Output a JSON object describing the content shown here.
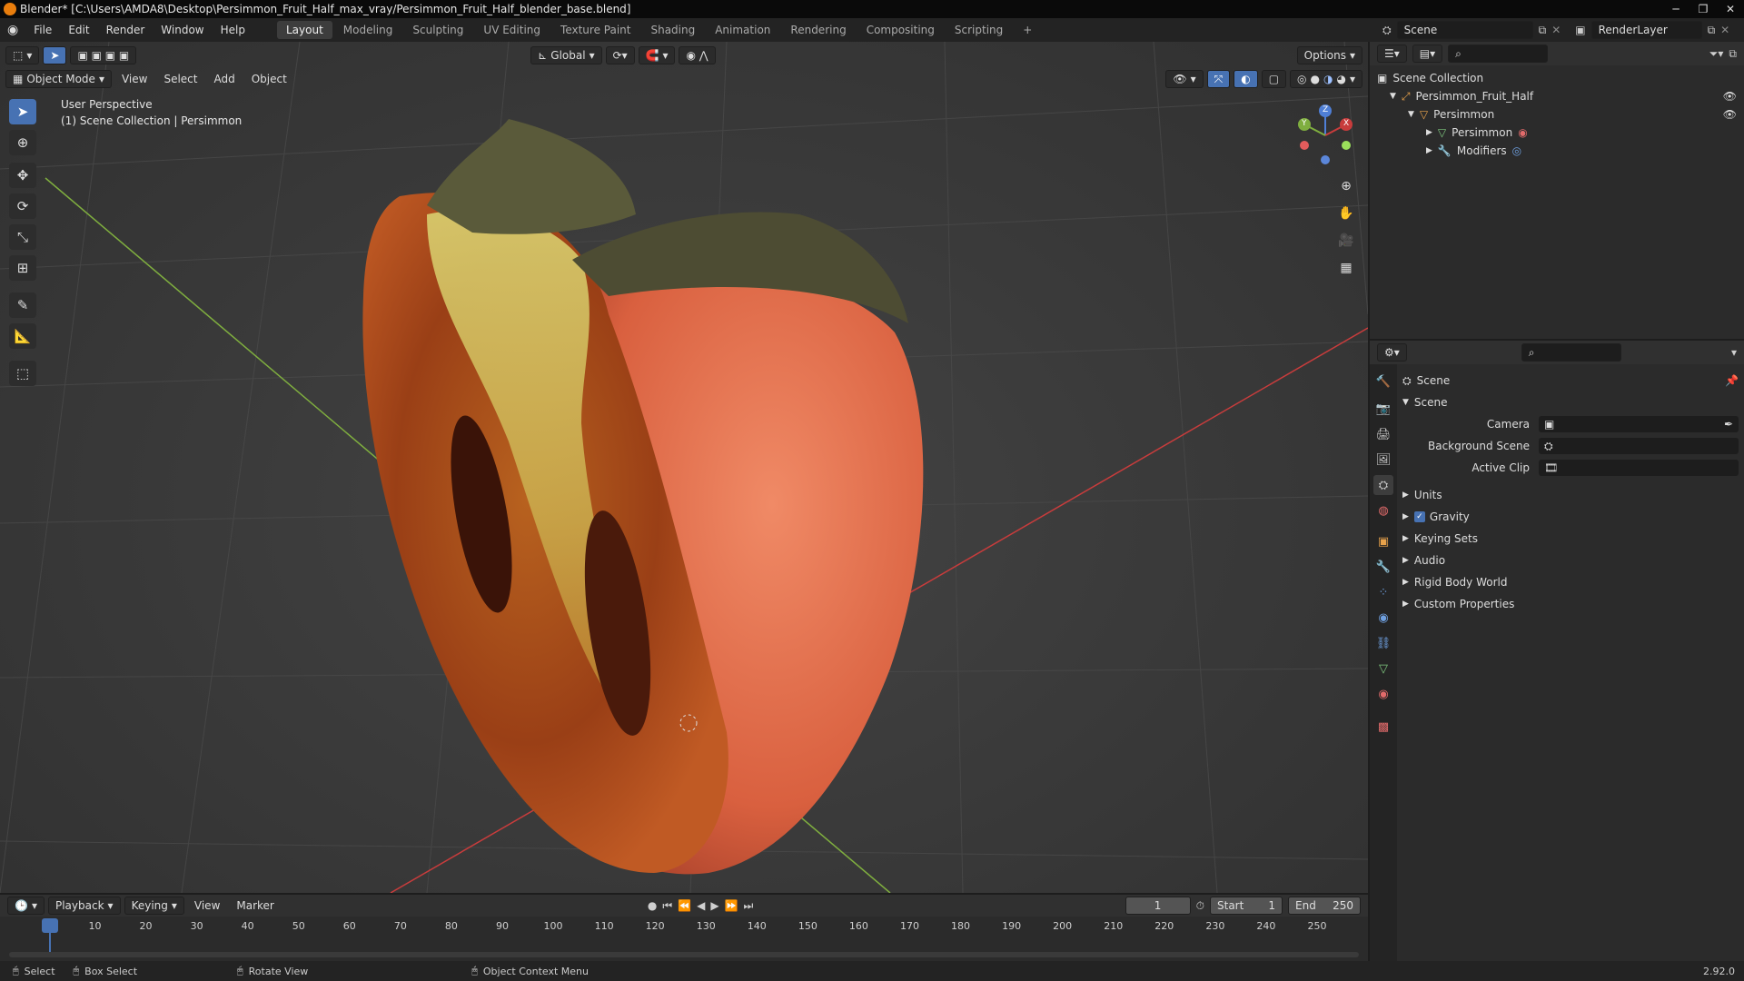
{
  "title_bar": {
    "title": "Blender* [C:\\Users\\AMDA8\\Desktop\\Persimmon_Fruit_Half_max_vray/Persimmon_Fruit_Half_blender_base.blend]"
  },
  "menus": [
    "File",
    "Edit",
    "Render",
    "Window",
    "Help"
  ],
  "workspaces": [
    "Layout",
    "Modeling",
    "Sculpting",
    "UV Editing",
    "Texture Paint",
    "Shading",
    "Animation",
    "Rendering",
    "Compositing",
    "Scripting"
  ],
  "active_workspace": "Layout",
  "scene_name": "Scene",
  "render_layer": "RenderLayer",
  "viewport": {
    "mode": "Object Mode",
    "menus": [
      "View",
      "Select",
      "Add",
      "Object"
    ],
    "orientation": "Global",
    "options_label": "Options",
    "overlay_line1": "User Perspective",
    "overlay_line2": "(1) Scene Collection | Persimmon",
    "gizmo": {
      "x": "X",
      "y": "Y",
      "z": "Z"
    }
  },
  "outliner": {
    "root": "Scene Collection",
    "items": [
      {
        "label": "Persimmon_Fruit_Half"
      },
      {
        "label": "Persimmon"
      },
      {
        "label": "Persimmon"
      },
      {
        "label": "Modifiers"
      }
    ]
  },
  "properties": {
    "context": "Scene",
    "section": "Scene",
    "rows": [
      {
        "label": "Camera"
      },
      {
        "label": "Background Scene"
      },
      {
        "label": "Active Clip"
      }
    ],
    "subpanels": [
      "Units",
      "Gravity",
      "Keying Sets",
      "Audio",
      "Rigid Body World",
      "Custom Properties"
    ]
  },
  "timeline": {
    "menus": [
      "Playback",
      "Keying",
      "View",
      "Marker"
    ],
    "current_frame": "1",
    "start_label": "Start",
    "start": "1",
    "end_label": "End",
    "end": "250",
    "ticks": [
      "1",
      "10",
      "20",
      "30",
      "40",
      "50",
      "60",
      "70",
      "80",
      "90",
      "100",
      "110",
      "120",
      "130",
      "140",
      "150",
      "160",
      "170",
      "180",
      "190",
      "200",
      "210",
      "220",
      "230",
      "240",
      "250"
    ]
  },
  "statusbar": {
    "select": "Select",
    "box_select": "Box Select",
    "rotate": "Rotate View",
    "context_menu": "Object Context Menu",
    "version": "2.92.0"
  },
  "colors": {
    "accent": "#4772b3",
    "x_axis": "#c83c3c",
    "y_axis": "#7fae3f",
    "fruit": "#e0684a"
  }
}
